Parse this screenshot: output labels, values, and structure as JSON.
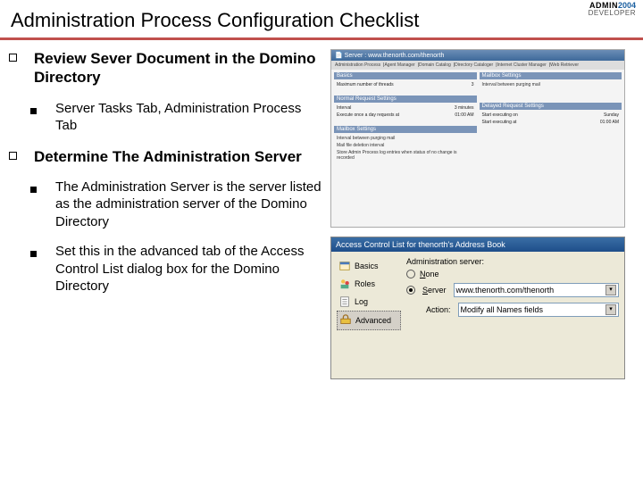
{
  "slide": {
    "title": "Administration Process Configuration Checklist",
    "logo": {
      "top": "ADMIN",
      "year": "2004",
      "bottom": "DEVELOPER"
    }
  },
  "items": {
    "h1": "Review Sever Document in the Domino Directory",
    "s1": "Server Tasks Tab, Administration Process Tab",
    "h2": "Determine The Administration Server",
    "s2": "The Administration Server is the server listed as the administration server of the Domino Directory",
    "s3": "Set this in the advanced tab of the Access Control List dialog box for the Domino Directory"
  },
  "shot1": {
    "title": "Server : www.thenorth.com/thenorth",
    "tabs": [
      "Administration Process",
      "Agent Manager",
      "Domain Catalog",
      "Directory Cataloger",
      "Internet Cluster Manager",
      "Web Retriever"
    ],
    "basics": {
      "header": "Basics",
      "maxthreads_label": "Maximum number of threads",
      "maxthreads_value": "3"
    },
    "mailbox": {
      "header": "Mailbox Settings",
      "l1": "Interval between purging mail",
      "l2": "Mail file deletion interval",
      "l3": "Store Admin Process log entries when status of no change is recorded"
    },
    "normal": {
      "header": "Normal Request Settings",
      "interval_label": "Interval",
      "interval_value": "3 minutes",
      "exec_label": "Execute once a day requests at",
      "exec_value": "01:00 AM"
    },
    "delayed": {
      "header": "Delayed Request Settings",
      "start_label": "Start executing on",
      "start_value": "Sunday",
      "end_label": "Start executing at",
      "end_value": "01:00 AM"
    }
  },
  "shot2": {
    "title": "Access Control List for thenorth's Address Book",
    "side": {
      "basics": "Basics",
      "roles": "Roles",
      "log": "Log",
      "advanced": "Advanced"
    },
    "main": {
      "label": "Administration server:",
      "radio_none": "None",
      "radio_server": "Server",
      "server_value": "www.thenorth.com/thenorth",
      "action_label": "Action:",
      "action_value": "Modify all Names fields"
    }
  }
}
